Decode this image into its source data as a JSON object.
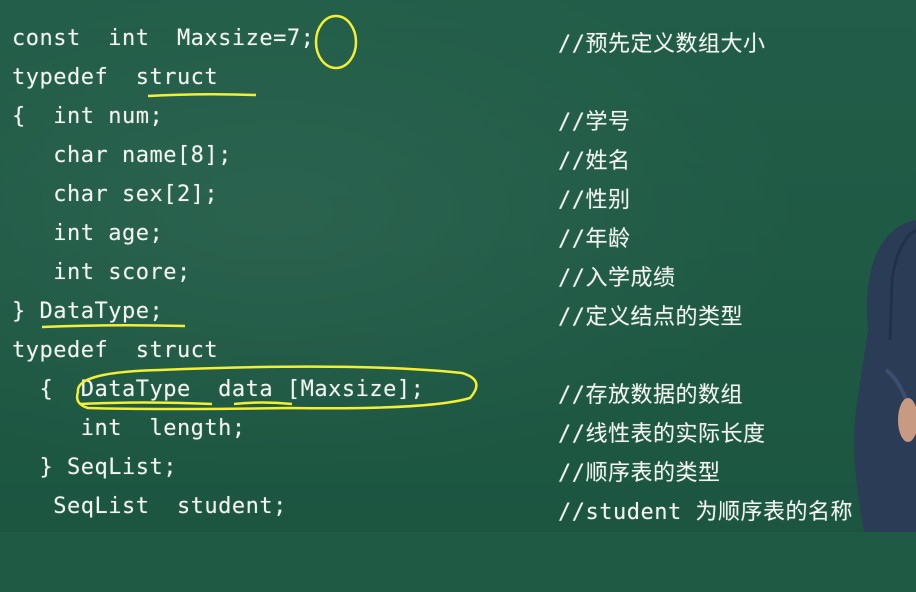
{
  "code_lines": [
    {
      "code": "const  int  Maxsize=7;",
      "comment": "//预先定义数组大小"
    },
    {
      "code": "typedef  struct",
      "comment": ""
    },
    {
      "code": "{  int num;",
      "comment": "//学号"
    },
    {
      "code": "   char name[8];",
      "comment": "//姓名"
    },
    {
      "code": "   char sex[2];",
      "comment": "//性别"
    },
    {
      "code": "   int age;",
      "comment": "//年龄"
    },
    {
      "code": "   int score;",
      "comment": "//入学成绩"
    },
    {
      "code": "} DataType;",
      "comment": "//定义结点的类型"
    },
    {
      "code": "typedef  struct",
      "comment": ""
    },
    {
      "code": "  {  DataType  data [Maxsize];",
      "comment": "//存放数据的数组"
    },
    {
      "code": "     int  length;",
      "comment": "//线性表的实际长度"
    },
    {
      "code": "  } SeqList;",
      "comment": "//顺序表的类型"
    },
    {
      "code": "   SeqList  student;",
      "comment": "//student 为顺序表的名称"
    }
  ],
  "colors": {
    "board": "#1f5a45",
    "chalk": "#f3f5f2",
    "highlight": "#f2ef35"
  }
}
